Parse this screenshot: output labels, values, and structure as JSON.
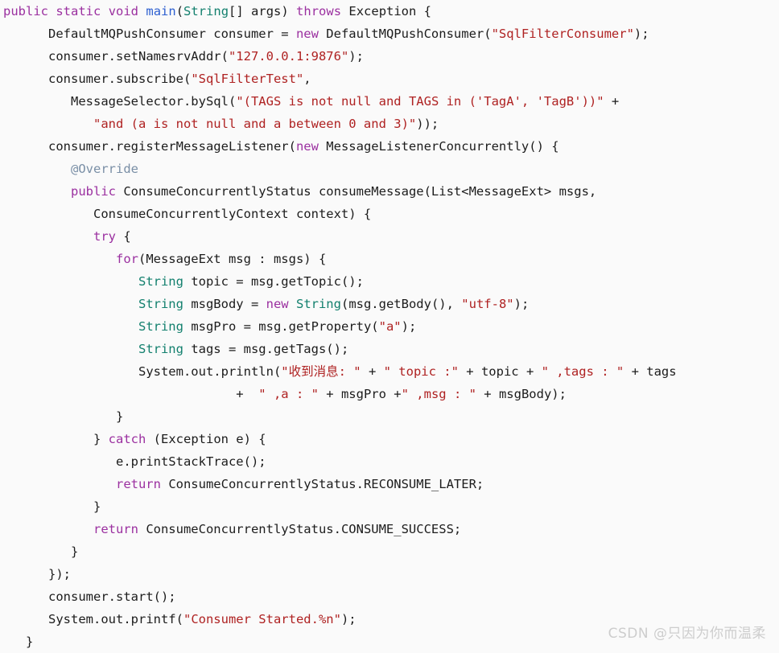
{
  "editor": {
    "language": "java",
    "background_color": "#fafafa",
    "default_text_color": "#1c1c1c",
    "theme_colors": {
      "keyword": "#9B30A0",
      "string": "#AF2222",
      "type": "#13806E",
      "function": "#2D5FD0",
      "annotation": "#7A8FA6",
      "plain": "#1c1c1c"
    },
    "lines": [
      {
        "indent": 0,
        "tokens": [
          {
            "t": "public",
            "c": "kw"
          },
          {
            "t": " ",
            "c": "plain"
          },
          {
            "t": "static",
            "c": "kw"
          },
          {
            "t": " ",
            "c": "plain"
          },
          {
            "t": "void",
            "c": "kw"
          },
          {
            "t": " ",
            "c": "plain"
          },
          {
            "t": "main",
            "c": "fn"
          },
          {
            "t": "(",
            "c": "plain"
          },
          {
            "t": "String",
            "c": "type"
          },
          {
            "t": "[] args) ",
            "c": "plain"
          },
          {
            "t": "throws",
            "c": "kw"
          },
          {
            "t": " Exception {",
            "c": "plain"
          }
        ]
      },
      {
        "indent": 6,
        "tokens": [
          {
            "t": "DefaultMQPushConsumer consumer = ",
            "c": "plain"
          },
          {
            "t": "new",
            "c": "kw"
          },
          {
            "t": " DefaultMQPushConsumer(",
            "c": "plain"
          },
          {
            "t": "\"SqlFilterConsumer\"",
            "c": "str"
          },
          {
            "t": ");",
            "c": "plain"
          }
        ]
      },
      {
        "indent": 6,
        "tokens": [
          {
            "t": "consumer.setNamesrvAddr(",
            "c": "plain"
          },
          {
            "t": "\"127.0.0.1:9876\"",
            "c": "str"
          },
          {
            "t": ");",
            "c": "plain"
          }
        ]
      },
      {
        "indent": 6,
        "tokens": [
          {
            "t": "consumer.subscribe(",
            "c": "plain"
          },
          {
            "t": "\"SqlFilterTest\"",
            "c": "str"
          },
          {
            "t": ",",
            "c": "plain"
          }
        ]
      },
      {
        "indent": 9,
        "tokens": [
          {
            "t": "MessageSelector.bySql(",
            "c": "plain"
          },
          {
            "t": "\"(TAGS is not null and TAGS in ('TagA', 'TagB'))\"",
            "c": "str"
          },
          {
            "t": " +",
            "c": "plain"
          }
        ]
      },
      {
        "indent": 12,
        "tokens": [
          {
            "t": "\"and (a is not null and a between 0 and 3)\"",
            "c": "str"
          },
          {
            "t": "));",
            "c": "plain"
          }
        ]
      },
      {
        "indent": 6,
        "tokens": [
          {
            "t": "consumer.registerMessageListener(",
            "c": "plain"
          },
          {
            "t": "new",
            "c": "kw"
          },
          {
            "t": " MessageListenerConcurrently() {",
            "c": "plain"
          }
        ]
      },
      {
        "indent": 9,
        "tokens": [
          {
            "t": "@Override",
            "c": "ann"
          }
        ]
      },
      {
        "indent": 9,
        "tokens": [
          {
            "t": "public",
            "c": "kw"
          },
          {
            "t": " ConsumeConcurrentlyStatus consumeMessage(List<MessageExt> msgs,",
            "c": "plain"
          }
        ]
      },
      {
        "indent": 12,
        "tokens": [
          {
            "t": "ConsumeConcurrentlyContext context) {",
            "c": "plain"
          }
        ]
      },
      {
        "indent": 12,
        "tokens": [
          {
            "t": "try",
            "c": "kw"
          },
          {
            "t": " {",
            "c": "plain"
          }
        ]
      },
      {
        "indent": 15,
        "tokens": [
          {
            "t": "for",
            "c": "kw"
          },
          {
            "t": "(MessageExt msg : msgs) {",
            "c": "plain"
          }
        ]
      },
      {
        "indent": 18,
        "tokens": [
          {
            "t": "String",
            "c": "type"
          },
          {
            "t": " topic = msg.getTopic();",
            "c": "plain"
          }
        ]
      },
      {
        "indent": 18,
        "tokens": [
          {
            "t": "String",
            "c": "type"
          },
          {
            "t": " msgBody = ",
            "c": "plain"
          },
          {
            "t": "new",
            "c": "kw"
          },
          {
            "t": " ",
            "c": "plain"
          },
          {
            "t": "String",
            "c": "type"
          },
          {
            "t": "(msg.getBody(), ",
            "c": "plain"
          },
          {
            "t": "\"utf-8\"",
            "c": "str"
          },
          {
            "t": ");",
            "c": "plain"
          }
        ]
      },
      {
        "indent": 18,
        "tokens": [
          {
            "t": "String",
            "c": "type"
          },
          {
            "t": " msgPro = msg.getProperty(",
            "c": "plain"
          },
          {
            "t": "\"a\"",
            "c": "str"
          },
          {
            "t": ");",
            "c": "plain"
          }
        ]
      },
      {
        "indent": 18,
        "tokens": [
          {
            "t": "String",
            "c": "type"
          },
          {
            "t": " tags = msg.getTags();",
            "c": "plain"
          }
        ]
      },
      {
        "indent": 18,
        "tokens": [
          {
            "t": "System.out.println(",
            "c": "plain"
          },
          {
            "t": "\"收到消息: \"",
            "c": "str"
          },
          {
            "t": " + ",
            "c": "plain"
          },
          {
            "t": "\" topic :\"",
            "c": "str"
          },
          {
            "t": " + topic + ",
            "c": "plain"
          },
          {
            "t": "\" ,tags : \"",
            "c": "str"
          },
          {
            "t": " + tags",
            "c": "plain"
          }
        ]
      },
      {
        "indent": 31,
        "tokens": [
          {
            "t": "+ ",
            "c": "plain"
          },
          {
            "t": " \" ,a : \"",
            "c": "str"
          },
          {
            "t": " + msgPro +",
            "c": "plain"
          },
          {
            "t": "\" ,msg : \"",
            "c": "str"
          },
          {
            "t": " + msgBody);",
            "c": "plain"
          }
        ]
      },
      {
        "indent": 15,
        "tokens": [
          {
            "t": "}",
            "c": "plain"
          }
        ]
      },
      {
        "indent": 12,
        "tokens": [
          {
            "t": "} ",
            "c": "plain"
          },
          {
            "t": "catch",
            "c": "kw"
          },
          {
            "t": " (Exception e) {",
            "c": "plain"
          }
        ]
      },
      {
        "indent": 15,
        "tokens": [
          {
            "t": "e.printStackTrace();",
            "c": "plain"
          }
        ]
      },
      {
        "indent": 15,
        "tokens": [
          {
            "t": "return",
            "c": "kw"
          },
          {
            "t": " ConsumeConcurrentlyStatus.RECONSUME_LATER;",
            "c": "plain"
          }
        ]
      },
      {
        "indent": 12,
        "tokens": [
          {
            "t": "}",
            "c": "plain"
          }
        ]
      },
      {
        "indent": 12,
        "tokens": [
          {
            "t": "return",
            "c": "kw"
          },
          {
            "t": " ConsumeConcurrentlyStatus.CONSUME_SUCCESS;",
            "c": "plain"
          }
        ]
      },
      {
        "indent": 9,
        "tokens": [
          {
            "t": "}",
            "c": "plain"
          }
        ]
      },
      {
        "indent": 6,
        "tokens": [
          {
            "t": "});",
            "c": "plain"
          }
        ]
      },
      {
        "indent": 6,
        "tokens": [
          {
            "t": "consumer.start();",
            "c": "plain"
          }
        ]
      },
      {
        "indent": 6,
        "tokens": [
          {
            "t": "System.out.printf(",
            "c": "plain"
          },
          {
            "t": "\"Consumer Started.%n\"",
            "c": "str"
          },
          {
            "t": ");",
            "c": "plain"
          }
        ]
      },
      {
        "indent": 3,
        "tokens": [
          {
            "t": "}",
            "c": "plain"
          }
        ]
      }
    ]
  },
  "watermark": {
    "text": "CSDN @只因为你而温柔",
    "color": "#cdcdcd"
  }
}
